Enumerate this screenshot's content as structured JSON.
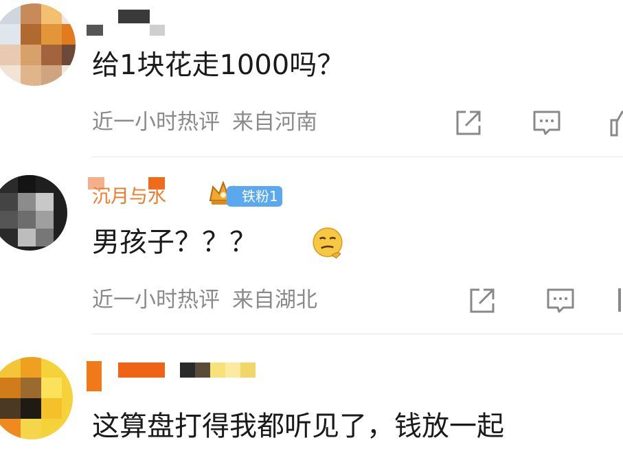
{
  "comments": [
    {
      "text": "给1块花走1000吗？",
      "time": "近一小时热评",
      "location": "来自河南"
    },
    {
      "username": "沉月与水",
      "badge": "铁粉1",
      "text": "男孩子？？？",
      "time": "近一小时热评",
      "location": "来自湖北"
    },
    {
      "text": "这算盘打得我都听见了，钱放一起"
    }
  ],
  "colors": {
    "meta_text": "#8a8a8a",
    "badge_bg": "#5aa8f0",
    "username": "#f07a2a"
  }
}
